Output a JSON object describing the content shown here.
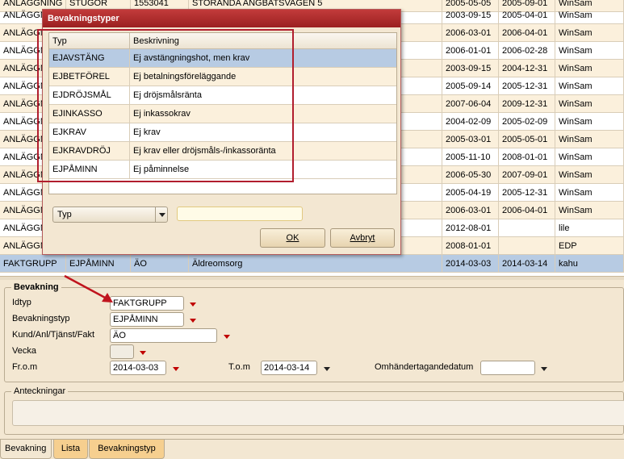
{
  "grid": {
    "rows": [
      {
        "c0": "ANLÄGGNING",
        "c1": "STUGOR",
        "c2": "1553041",
        "c3": "STORANDA ANGBATSVAGEN 5",
        "c4": "2005-05-05",
        "c5": "2005-09-01",
        "c6": "WinSam"
      },
      {
        "c0": "ANLÄGGN",
        "c1": "",
        "c2": "",
        "c3": "",
        "c4": "2003-09-15",
        "c5": "2005-04-01",
        "c6": "WinSam"
      },
      {
        "c0": "ANLÄGGN",
        "c1": "",
        "c2": "",
        "c3": "",
        "c4": "2006-03-01",
        "c5": "2006-04-01",
        "c6": "WinSam"
      },
      {
        "c0": "ANLÄGGN",
        "c1": "",
        "c2": "",
        "c3": "",
        "c4": "2006-01-01",
        "c5": "2006-02-28",
        "c6": "WinSam"
      },
      {
        "c0": "ANLÄGGN",
        "c1": "",
        "c2": "",
        "c3": "",
        "c4": "2003-09-15",
        "c5": "2004-12-31",
        "c6": "WinSam"
      },
      {
        "c0": "ANLÄGGN",
        "c1": "",
        "c2": "",
        "c3": "",
        "c4": "2005-09-14",
        "c5": "2005-12-31",
        "c6": "WinSam"
      },
      {
        "c0": "ANLÄGGN",
        "c1": "",
        "c2": "",
        "c3": "",
        "c4": "2007-06-04",
        "c5": "2009-12-31",
        "c6": "WinSam"
      },
      {
        "c0": "ANLÄGGN",
        "c1": "",
        "c2": "",
        "c3": "",
        "c4": "2004-02-09",
        "c5": "2005-02-09",
        "c6": "WinSam"
      },
      {
        "c0": "ANLÄGGN",
        "c1": "",
        "c2": "",
        "c3": "",
        "c4": "2005-03-01",
        "c5": "2005-05-01",
        "c6": "WinSam"
      },
      {
        "c0": "ANLÄGGN",
        "c1": "",
        "c2": "",
        "c3": "",
        "c4": "2005-11-10",
        "c5": "2008-01-01",
        "c6": "WinSam"
      },
      {
        "c0": "ANLÄGGN",
        "c1": "",
        "c2": "",
        "c3": "",
        "c4": "2006-05-30",
        "c5": "2007-09-01",
        "c6": "WinSam"
      },
      {
        "c0": "ANLÄGGN",
        "c1": "",
        "c2": "",
        "c3": "",
        "c4": "2005-04-19",
        "c5": "2005-12-31",
        "c6": "WinSam"
      },
      {
        "c0": "ANLÄGGN",
        "c1": "",
        "c2": "",
        "c3": "",
        "c4": "2006-03-01",
        "c5": "2006-04-01",
        "c6": "WinSam"
      },
      {
        "c0": "ANLÄGGN",
        "c1": "",
        "c2": "",
        "c3": "",
        "c4": "2012-08-01",
        "c5": "",
        "c6": "lile"
      },
      {
        "c0": "ANLÄGGN",
        "c1": "",
        "c2": "",
        "c3": "",
        "c4": "2008-01-01",
        "c5": "",
        "c6": "EDP"
      },
      {
        "c0": "FAKTGRUPP",
        "c1": "EJPÅMINN",
        "c2": "ÄO",
        "c3": "Äldreomsorg",
        "c4": "2014-03-03",
        "c5": "2014-03-14",
        "c6": "kahu"
      }
    ]
  },
  "dialog": {
    "title": "Bevakningstyper",
    "col_typ": "Typ",
    "col_beskrivning": "Beskrivning",
    "items": [
      {
        "typ": "EJAVSTÄNG",
        "beskrivning": "Ej avstängningshot, men krav"
      },
      {
        "typ": "EJBETFÖREL",
        "beskrivning": "Ej betalningsföreläggande"
      },
      {
        "typ": "EJDRÖJSMÅL",
        "beskrivning": "Ej dröjsmålsränta"
      },
      {
        "typ": "EJINKASSO",
        "beskrivning": "Ej inkassokrav"
      },
      {
        "typ": "EJKRAV",
        "beskrivning": "Ej krav"
      },
      {
        "typ": "EJKRAVDRÖJ",
        "beskrivning": "Ej krav eller dröjsmåls-/inkassoränta"
      },
      {
        "typ": "EJPÅMINN",
        "beskrivning": "Ej påminnelse"
      }
    ],
    "search_field_select": "Typ",
    "search_value": "",
    "ok_label": "OK",
    "cancel_label": "Avbryt"
  },
  "bevakning": {
    "legend": "Bevakning",
    "idtyp_label": "Idtyp",
    "idtyp_value": "FAKTGRUPP",
    "bevakningstyp_label": "Bevakningstyp",
    "bevakningstyp_value": "EJPÅMINN",
    "kund_label": "Kund/Anl/Tjänst/Fakt",
    "kund_value": "ÄO",
    "vecka_label": "Vecka",
    "vecka_value": "",
    "from_label": "Fr.o.m",
    "from_value": "2014-03-03",
    "tom_label": "T.o.m",
    "tom_value": "2014-03-14",
    "omh_label": "Omhändertagandedatum",
    "omh_value": ""
  },
  "anteckningar": {
    "legend": "Anteckningar",
    "value": ""
  },
  "tabs": [
    "Bevakning",
    "Lista",
    "Bevakningstyp"
  ],
  "colors": {
    "title_bar": "#b02a2a",
    "selection": "#b7cbe3",
    "panel": "#f3e7d2",
    "tab": "#f6cf8f",
    "highlight_frame": "#b11e2e",
    "arrow": "#c0141e"
  }
}
